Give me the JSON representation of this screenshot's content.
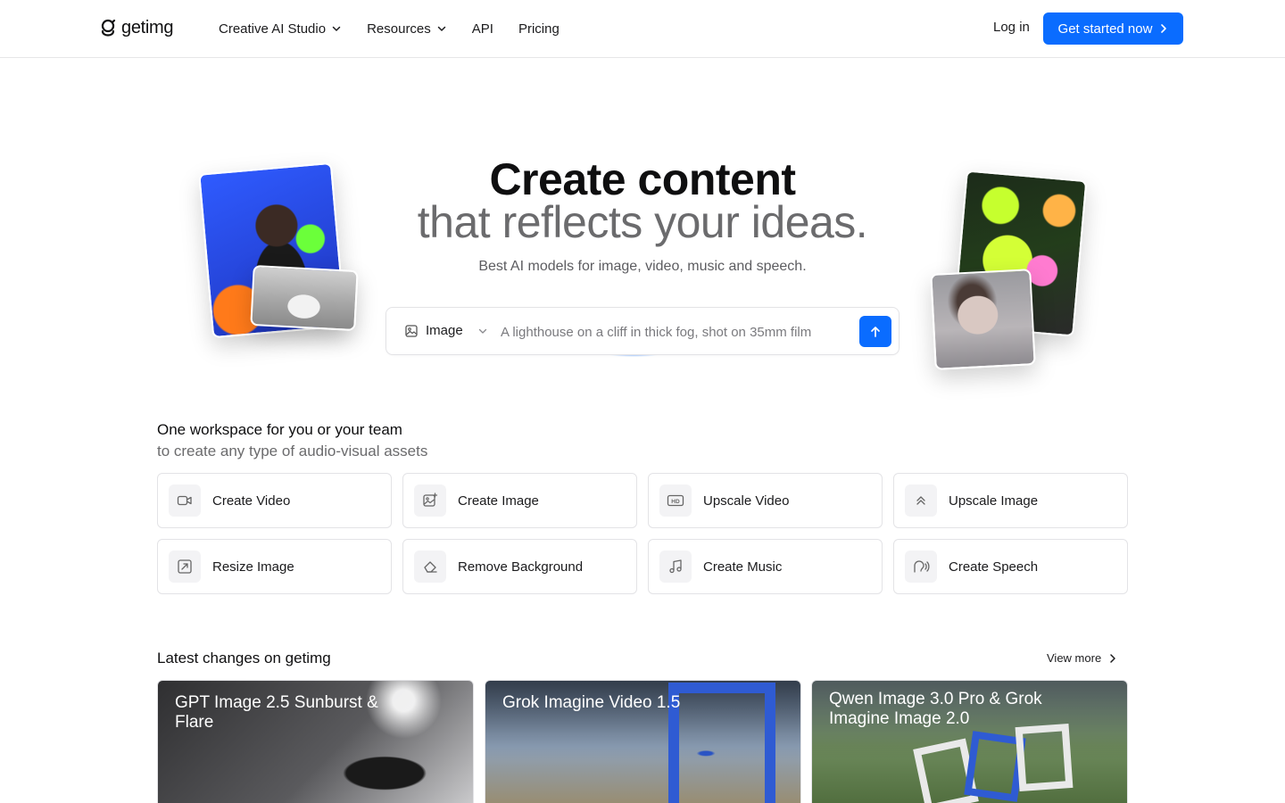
{
  "header": {
    "logo_text": "getimg",
    "nav": [
      {
        "label": "Creative AI Studio",
        "has_dropdown": true
      },
      {
        "label": "Resources",
        "has_dropdown": true
      },
      {
        "label": "API",
        "has_dropdown": false
      },
      {
        "label": "Pricing",
        "has_dropdown": false
      }
    ],
    "login_label": "Log in",
    "cta_label": "Get started now",
    "cta_color": "#0a6cff"
  },
  "hero": {
    "title_line1": "Create content",
    "title_line2": "that reflects your ideas.",
    "subtitle": "Best AI models for image, video, music and speech.",
    "prompt": {
      "mode_label": "Image",
      "mode_icon": "image-icon",
      "placeholder": "A lighthouse on a cliff in thick fog, shot on 35mm film",
      "send_icon": "arrow-up-icon"
    }
  },
  "workspace": {
    "title": "One workspace for you or your team",
    "subtitle": "to create any type of audio-visual assets",
    "tools": [
      {
        "label": "Create Video",
        "icon": "video-camera-icon"
      },
      {
        "label": "Create Image",
        "icon": "image-sparkle-icon"
      },
      {
        "label": "Upscale Video",
        "icon": "hd-icon"
      },
      {
        "label": "Upscale Image",
        "icon": "double-chevron-up-icon"
      },
      {
        "label": "Resize Image",
        "icon": "resize-icon"
      },
      {
        "label": "Remove Background",
        "icon": "eraser-icon"
      },
      {
        "label": "Create Music",
        "icon": "music-note-icon"
      },
      {
        "label": "Create Speech",
        "icon": "speech-icon"
      }
    ]
  },
  "latest": {
    "title": "Latest changes on getimg",
    "view_more_label": "View more",
    "cards": [
      {
        "title": "GPT Image 2.5 Sunburst & Flare"
      },
      {
        "title": "Grok Imagine Video 1.5"
      },
      {
        "title": "Qwen Image 3.0 Pro & Grok Imagine Image 2.0"
      }
    ]
  }
}
